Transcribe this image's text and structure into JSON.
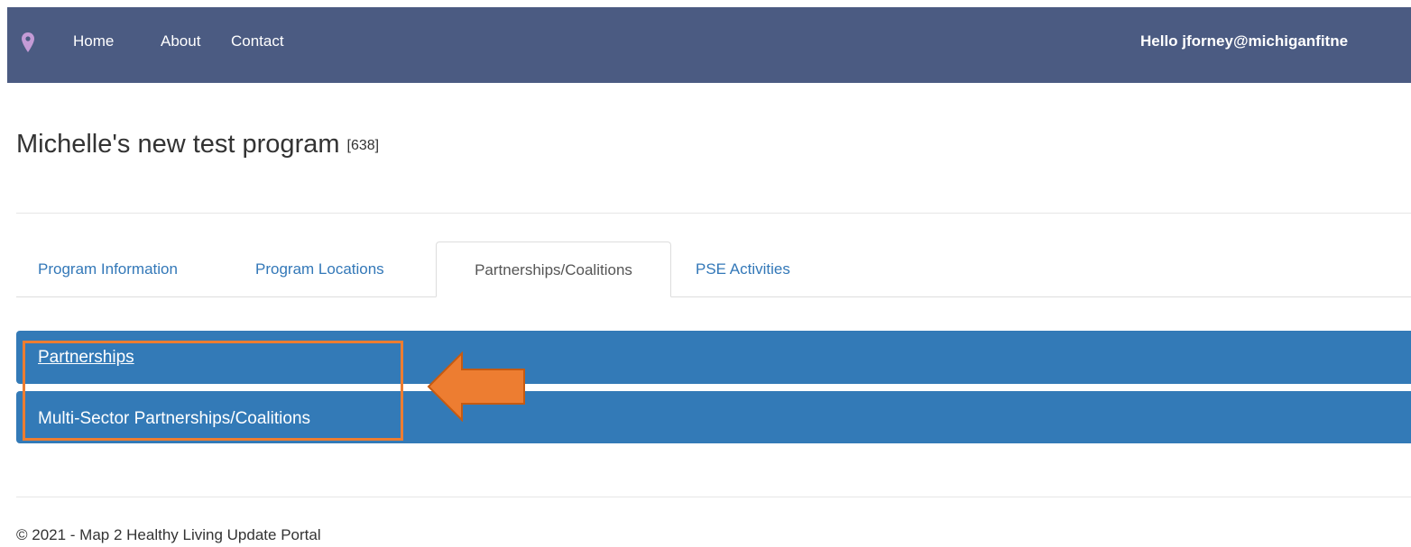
{
  "navbar": {
    "pin_icon": "map-marker-icon",
    "links": [
      {
        "label": "Home"
      },
      {
        "label": "About"
      },
      {
        "label": "Contact"
      }
    ],
    "greeting": "Hello jforney@michiganfitne",
    "accent_color": "#4b5b82"
  },
  "program": {
    "title": "Michelle's new test program",
    "id": "[638]"
  },
  "tabs": [
    {
      "label": "Program Information",
      "active": false
    },
    {
      "label": "Program Locations",
      "active": false
    },
    {
      "label": "Partnerships/Coalitions",
      "active": true
    },
    {
      "label": "PSE Activities",
      "active": false
    }
  ],
  "panels": [
    {
      "label": "Partnerships"
    },
    {
      "label": "Multi-Sector Partnerships/Coalitions"
    }
  ],
  "panel_color": "#337ab7",
  "annotation": {
    "highlight_color": "#ed7d31",
    "arrow_icon": "left-arrow-icon"
  },
  "footer": {
    "text": "© 2021 - Map 2 Healthy Living Update Portal"
  }
}
